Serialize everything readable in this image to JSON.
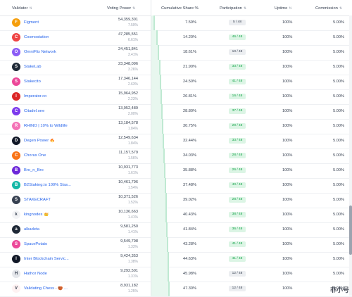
{
  "header": {
    "validator": "Validator",
    "voting_power": "Voting Power",
    "cumulative": "Cumulative Share %",
    "participation": "Participation",
    "uptime": "Uptime",
    "commission": "Commission",
    "sort_glyph": "⇅"
  },
  "rows": [
    {
      "name": "Figment",
      "vp": "54,359,301",
      "pct": "7.59%",
      "cum": "7.59%",
      "cum_value": 7.59,
      "part": "5 / 48",
      "part_status": "neutral",
      "uptime": "100%",
      "commission": "5.00%",
      "avatar_color": "#f59e0b",
      "avatar_icon": "figment-f-icon",
      "avatar_glyph": "F"
    },
    {
      "name": "Cosmostation",
      "vp": "47,285,551",
      "pct": "6.61%",
      "cum": "14.20%",
      "cum_value": 14.2,
      "part": "46 / 48",
      "part_status": "good",
      "uptime": "100%",
      "commission": "5.00%",
      "avatar_color": "#ef4444",
      "avatar_icon": "cosmostation-icon",
      "avatar_glyph": "C"
    },
    {
      "name": "OmniFlix Network",
      "vp": "24,451,841",
      "pct": "3.41%",
      "cum": "18.61%",
      "cum_value": 18.61,
      "part": "10 / 48",
      "part_status": "neutral",
      "uptime": "100%",
      "commission": "5.00%",
      "avatar_color": "#8b5cf6",
      "avatar_icon": "omniflix-icon",
      "avatar_glyph": "O"
    },
    {
      "name": "StakeLab",
      "vp": "23,348,096",
      "pct": "3.26%",
      "cum": "21.90%",
      "cum_value": 21.9,
      "part": "33 / 48",
      "part_status": "good",
      "uptime": "100%",
      "commission": "5.00%",
      "avatar_color": "#1f2937",
      "avatar_icon": "stakelab-icon",
      "avatar_glyph": "S"
    },
    {
      "name": "Stakecito",
      "vp": "17,346,144",
      "pct": "2.63%",
      "cum": "24.50%",
      "cum_value": 24.5,
      "part": "41 / 48",
      "part_status": "good",
      "uptime": "100%",
      "commission": "5.00%",
      "avatar_color": "#ec4899",
      "avatar_icon": "stakecito-icon",
      "avatar_glyph": "S"
    },
    {
      "name": "Imperator.co",
      "vp": "15,964,952",
      "pct": "2.23%",
      "cum": "26.81%",
      "cum_value": 26.81,
      "part": "16 / 48",
      "part_status": "good",
      "uptime": "100%",
      "commission": "5.00%",
      "avatar_color": "#dc2626",
      "avatar_icon": "imperator-icon",
      "avatar_glyph": "I"
    },
    {
      "name": "Citadel.one",
      "vp": "13,952,489",
      "pct": "2.00%",
      "cum": "28.80%",
      "cum_value": 28.8,
      "part": "37 / 48",
      "part_status": "good",
      "uptime": "100%",
      "commission": "5.00%",
      "avatar_color": "#7c3aed",
      "avatar_icon": "citadel-icon",
      "avatar_glyph": "C"
    },
    {
      "name": "RHINO | 10% to Wildlife",
      "vp": "13,184,578",
      "pct": "1.84%",
      "cum": "30.75%",
      "cum_value": 30.75,
      "part": "29 / 48",
      "part_status": "good",
      "uptime": "100%",
      "commission": "5.00%",
      "avatar_color": "#f472b6",
      "avatar_icon": "rhino-icon",
      "avatar_glyph": "R"
    },
    {
      "name": "Degen Power 🔥",
      "vp": "12,549,634",
      "pct": "1.84%",
      "cum": "32.44%",
      "cum_value": 32.44,
      "part": "33 / 48",
      "part_status": "good",
      "uptime": "100%",
      "commission": "5.00%",
      "avatar_color": "#111827",
      "avatar_icon": "degen-power-icon",
      "avatar_glyph": "D"
    },
    {
      "name": "Chorus One",
      "vp": "11,157,579",
      "pct": "1.56%",
      "cum": "34.03%",
      "cum_value": 34.03,
      "part": "28 / 48",
      "part_status": "good",
      "uptime": "100%",
      "commission": "5.00%",
      "avatar_color": "#f97316",
      "avatar_icon": "chorus-one-icon",
      "avatar_glyph": "C"
    },
    {
      "name": "Bro_n_Bro",
      "vp": "10,931,773",
      "pct": "1.61%",
      "cum": "35.88%",
      "cum_value": 35.88,
      "part": "26 / 48",
      "part_status": "good",
      "uptime": "100%",
      "commission": "5.00%",
      "avatar_color": "#6d28d9",
      "avatar_icon": "bro-n-bro-icon",
      "avatar_glyph": "B"
    },
    {
      "name": "B2Staking.to 100% Slas...",
      "vp": "10,461,796",
      "pct": "1.54%",
      "cum": "37.48%",
      "cum_value": 37.48,
      "part": "40 / 48",
      "part_status": "good",
      "uptime": "100%",
      "commission": "5.00%",
      "avatar_color": "#14b8a6",
      "avatar_icon": "b2staking-icon",
      "avatar_glyph": "B"
    },
    {
      "name": "STAKECRAFT",
      "vp": "10,371,526",
      "pct": "1.52%",
      "cum": "39.02%",
      "cum_value": 39.02,
      "part": "28 / 48",
      "part_status": "good",
      "uptime": "100%",
      "commission": "5.00%",
      "avatar_color": "#374151",
      "avatar_icon": "stakecraft-icon",
      "avatar_glyph": "S"
    },
    {
      "name": "kingnodes 👑",
      "vp": "10,136,663",
      "pct": "1.41%",
      "cum": "40.43%",
      "cum_value": 40.43,
      "part": "38 / 48",
      "part_status": "good",
      "uptime": "100%",
      "commission": "5.00%",
      "avatar_color": "#f3f4f6",
      "avatar_icon": "kingnodes-icon",
      "avatar_glyph": "k"
    },
    {
      "name": "alkadeta",
      "vp": "9,581,250",
      "pct": "1.41%",
      "cum": "41.84%",
      "cum_value": 41.84,
      "part": "36 / 48",
      "part_status": "good",
      "uptime": "100%",
      "commission": "5.00%",
      "avatar_color": "#1f2937",
      "avatar_icon": "alkadeta-icon",
      "avatar_glyph": "a"
    },
    {
      "name": "SpacePotato",
      "vp": "9,549,798",
      "pct": "1.33%",
      "cum": "43.28%",
      "cum_value": 43.28,
      "part": "41 / 48",
      "part_status": "good",
      "uptime": "100%",
      "commission": "5.00%",
      "avatar_color": "#ec4899",
      "avatar_icon": "spacepotato-icon",
      "avatar_glyph": "S"
    },
    {
      "name": "Inter Blockchain Servic...",
      "vp": "9,424,353",
      "pct": "1.38%",
      "cum": "44.63%",
      "cum_value": 44.63,
      "part": "41 / 48",
      "part_status": "good",
      "uptime": "100%",
      "commission": "5.00%",
      "avatar_color": "#111827",
      "avatar_icon": "ibs-icon",
      "avatar_glyph": "I"
    },
    {
      "name": "Hathor Node",
      "vp": "9,292,501",
      "pct": "1.31%",
      "cum": "45.98%",
      "cum_value": 45.98,
      "part": "12 / 48",
      "part_status": "neutral",
      "uptime": "100%",
      "commission": "5.00%",
      "avatar_color": "#e5e7eb",
      "avatar_icon": "hathor-node-icon",
      "avatar_glyph": "H"
    },
    {
      "name": "Validating Chess - 🏀 ...",
      "vp": "8,931,182",
      "pct": "1.25%",
      "cum": "47.30%",
      "cum_value": 47.3,
      "part": "12 / 48",
      "part_status": "neutral",
      "uptime": "100%",
      "commission": "5.00%",
      "avatar_color": "#fef2f2",
      "avatar_icon": "validating-chess-icon",
      "avatar_glyph": "V"
    }
  ],
  "watermark": "非小号"
}
